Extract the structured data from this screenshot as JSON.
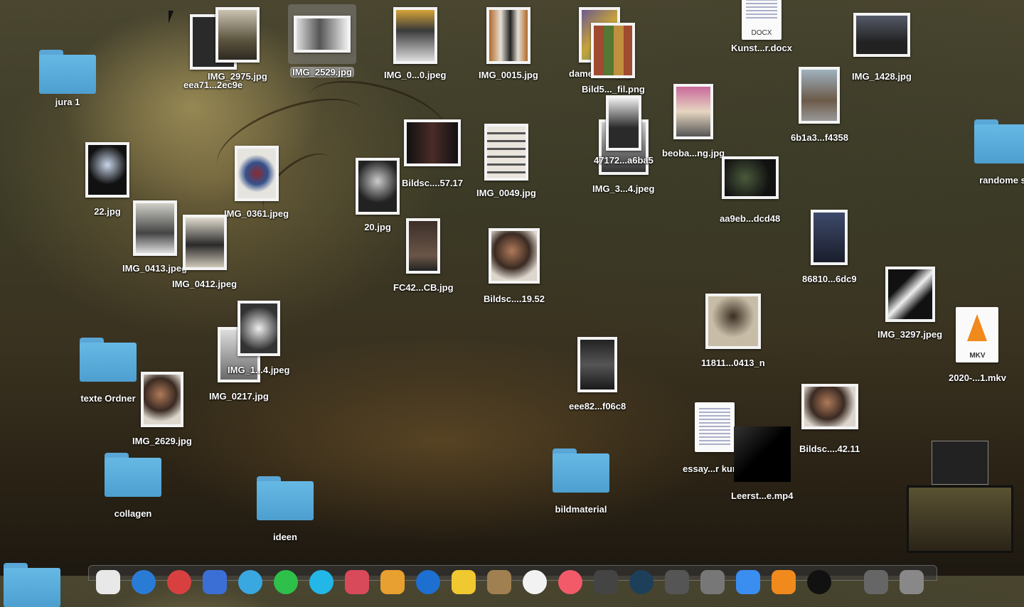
{
  "desktop": {
    "files": [
      {
        "label": "jura 1",
        "kind": "folder"
      },
      {
        "label": "eea71...2ec9e",
        "kind": "image"
      },
      {
        "label": "IMG_2975.jpg",
        "kind": "image"
      },
      {
        "label": "IMG_2529.jpg",
        "kind": "image",
        "selected": true
      },
      {
        "label": "IMG_0...0.jpeg",
        "kind": "image"
      },
      {
        "label": "IMG_0015.jpg",
        "kind": "image"
      },
      {
        "label": "dame_bea.jpg",
        "kind": "image"
      },
      {
        "label": "Bild5..._fil.png",
        "kind": "image"
      },
      {
        "label": "Kunst...r.docx",
        "kind": "document",
        "tag": "DOCX"
      },
      {
        "label": "IMG_1428.jpg",
        "kind": "image"
      },
      {
        "label": "6b1a3...f4358",
        "kind": "image"
      },
      {
        "label": "randome s",
        "kind": "folder"
      },
      {
        "label": "22.jpg",
        "kind": "image"
      },
      {
        "label": "IMG_0361.jpeg",
        "kind": "image"
      },
      {
        "label": "Bildsc....57.17",
        "kind": "image"
      },
      {
        "label": "IMG_0049.jpg",
        "kind": "image"
      },
      {
        "label": "47172...a6ba5",
        "kind": "image"
      },
      {
        "label": "IMG_3...4.jpeg",
        "kind": "image"
      },
      {
        "label": "beoba...ng.jpg",
        "kind": "image"
      },
      {
        "label": "aa9eb...dcd48",
        "kind": "image"
      },
      {
        "label": "20.jpg",
        "kind": "image"
      },
      {
        "label": "IMG_0413.jpeg",
        "kind": "image"
      },
      {
        "label": "IMG_0412.jpeg",
        "kind": "image"
      },
      {
        "label": "FC42...CB.jpg",
        "kind": "image"
      },
      {
        "label": "Bildsc....19.52",
        "kind": "image"
      },
      {
        "label": "86810...6dc9",
        "kind": "image"
      },
      {
        "label": "IMG_3297.jpeg",
        "kind": "image"
      },
      {
        "label": "11811...0413_n",
        "kind": "image"
      },
      {
        "label": "IMG_1...4.jpeg",
        "kind": "image"
      },
      {
        "label": "IMG_0217.jpg",
        "kind": "image"
      },
      {
        "label": "texte Ordner",
        "kind": "folder"
      },
      {
        "label": "IMG_2629.jpg",
        "kind": "image"
      },
      {
        "label": "eee82...f06c8",
        "kind": "image"
      },
      {
        "label": "2020-...1.mkv",
        "kind": "video",
        "tag": "MKV"
      },
      {
        "label": "essay...r kunst",
        "kind": "document"
      },
      {
        "label": "Leerst...e.mp4",
        "kind": "video"
      },
      {
        "label": "Bildsc....42.11",
        "kind": "image"
      },
      {
        "label": "collagen",
        "kind": "folder"
      },
      {
        "label": "ideen",
        "kind": "folder"
      },
      {
        "label": "bildmaterial",
        "kind": "folder"
      }
    ]
  },
  "colors": {
    "folder": "#5aa6d6",
    "selection": "#aaaaaa",
    "label": "#ffffff"
  }
}
